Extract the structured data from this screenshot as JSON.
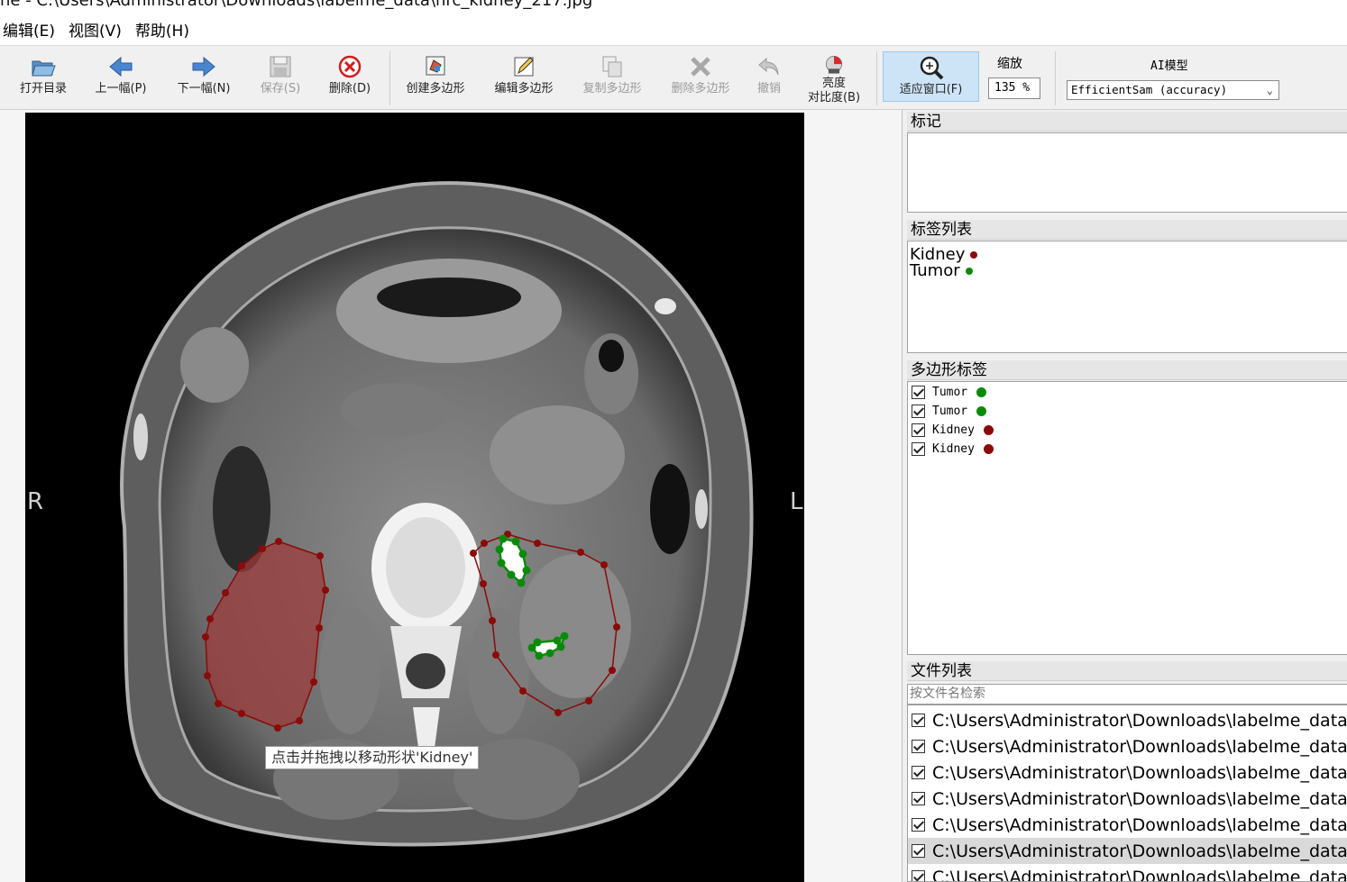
{
  "window": {
    "title": "ne - C:\\Users\\Administrator\\Downloads\\labelme_data\\nrc_kidney_217.jpg"
  },
  "menu": [
    "编辑(E)",
    "视图(V)",
    "帮助(H)"
  ],
  "toolbar": {
    "open_dir": "打开目录",
    "prev": "上一幅(P)",
    "next": "下一幅(N)",
    "save": "保存(S)",
    "delete": "删除(D)",
    "create_polygon": "创建多边形",
    "edit_polygon": "编辑多边形",
    "copy_polygon": "复制多边形",
    "delete_polygon": "删除多边形",
    "undo": "撤销",
    "brightness_line1": "亮度",
    "brightness_line2": "对比度(B)",
    "fit_window": "适应窗口(F)",
    "zoom_label": "缩放",
    "zoom_value": "135 %",
    "ai_model_label": "AI模型",
    "ai_model_value": "EfficientSam (accuracy)"
  },
  "canvas": {
    "orientation_left": "R",
    "orientation_right": "L",
    "tooltip": "点击并拖拽以移动形状'Kidney'"
  },
  "dock": {
    "flags_title": "标记",
    "label_list_title": "标签列表",
    "label_list": [
      {
        "name": "Kidney",
        "color": "#8b0a0a"
      },
      {
        "name": "Tumor",
        "color": "#0a8a0a"
      }
    ],
    "polygon_title": "多边形标签",
    "polygons": [
      {
        "name": "Tumor",
        "color": "#0a8a0a",
        "checked": true
      },
      {
        "name": "Tumor",
        "color": "#0a8a0a",
        "checked": true
      },
      {
        "name": "Kidney",
        "color": "#8b0a0a",
        "checked": true
      },
      {
        "name": "Kidney",
        "color": "#8b0a0a",
        "checked": true
      }
    ],
    "file_title": "文件列表",
    "file_search_placeholder": "按文件名检索",
    "files": [
      "C:\\Users\\Administrator\\Downloads\\labelme_data",
      "C:\\Users\\Administrator\\Downloads\\labelme_data",
      "C:\\Users\\Administrator\\Downloads\\labelme_data",
      "C:\\Users\\Administrator\\Downloads\\labelme_data",
      "C:\\Users\\Administrator\\Downloads\\labelme_data",
      "C:\\Users\\Administrator\\Downloads\\labelme_data",
      "C:\\Users\\Administrator\\Downloads\\labelme_data"
    ],
    "selected_file_index": 5
  },
  "colors": {
    "kidney": "#8b0a0a",
    "tumor": "#0a8a0a",
    "kidney_fill": "#9e3a3a",
    "active_button": "#cde4f7"
  }
}
